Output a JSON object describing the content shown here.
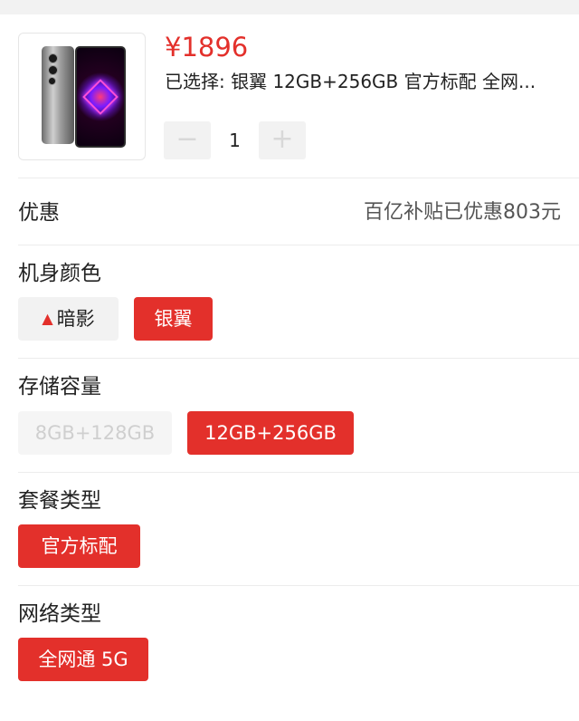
{
  "product": {
    "price": "¥1896",
    "selected_text": "已选择: 银翼 12GB+256GB 官方标配 全网...",
    "quantity": "1",
    "minus_symbol": "−",
    "plus_symbol": "+"
  },
  "promo": {
    "label": "优惠",
    "value": "百亿补贴已优惠803元"
  },
  "color": {
    "title": "机身颜色",
    "options": [
      {
        "label": "暗影",
        "state": "normal",
        "icon": "flame-icon"
      },
      {
        "label": "银翼",
        "state": "selected"
      }
    ]
  },
  "storage": {
    "title": "存储容量",
    "options": [
      {
        "label": "8GB+128GB",
        "state": "disabled"
      },
      {
        "label": "12GB+256GB",
        "state": "selected"
      }
    ]
  },
  "package": {
    "title": "套餐类型",
    "options": [
      {
        "label": "官方标配",
        "state": "selected"
      }
    ]
  },
  "network": {
    "title": "网络类型",
    "options": [
      {
        "label": "全网通 5G",
        "state": "selected"
      }
    ]
  },
  "colors": {
    "accent": "#e3302b",
    "chip_bg": "#f2f2f2",
    "disabled_text": "#cfcfcf"
  }
}
